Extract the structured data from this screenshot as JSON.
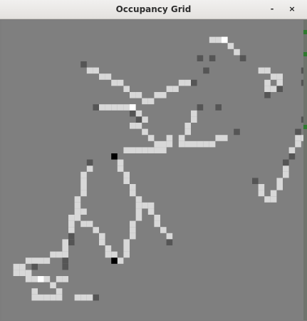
{
  "window": {
    "title": "Occupancy Grid",
    "minimize_label": "-",
    "close_label": "×"
  },
  "colors": {
    "unknown": "#7f7f7f",
    "free": "#d8d8d8",
    "occupied": "#555555",
    "robot": "#000000",
    "highlight": "#ffffff",
    "edge_marker": "#2f7a2f"
  },
  "grid": {
    "free": [
      [
        33,
        1
      ],
      [
        34,
        1
      ],
      [
        35,
        1
      ],
      [
        36,
        2
      ],
      [
        37,
        3
      ],
      [
        13,
        6
      ],
      [
        14,
        6
      ],
      [
        15,
        7
      ],
      [
        16,
        7
      ],
      [
        17,
        8
      ],
      [
        18,
        8
      ],
      [
        19,
        9
      ],
      [
        20,
        10
      ],
      [
        21,
        10
      ],
      [
        22,
        11
      ],
      [
        29,
        8
      ],
      [
        28,
        8
      ],
      [
        27,
        9
      ],
      [
        26,
        9
      ],
      [
        25,
        10
      ],
      [
        24,
        10
      ],
      [
        23,
        11
      ],
      [
        41,
        6
      ],
      [
        42,
        6
      ],
      [
        43,
        7
      ],
      [
        44,
        7
      ],
      [
        42,
        8
      ],
      [
        42,
        9
      ],
      [
        43,
        9
      ],
      [
        44,
        8
      ],
      [
        15,
        12
      ],
      [
        16,
        12
      ],
      [
        17,
        12
      ],
      [
        18,
        12
      ],
      [
        19,
        12
      ],
      [
        20,
        12
      ],
      [
        21,
        13
      ],
      [
        21,
        14
      ],
      [
        22,
        14
      ],
      [
        20,
        15
      ],
      [
        21,
        15
      ],
      [
        22,
        16
      ],
      [
        23,
        17
      ],
      [
        24,
        18
      ],
      [
        25,
        18
      ],
      [
        26,
        18
      ],
      [
        26,
        17
      ],
      [
        25,
        19
      ],
      [
        19,
        19
      ],
      [
        20,
        19
      ],
      [
        21,
        19
      ],
      [
        22,
        19
      ],
      [
        23,
        19
      ],
      [
        24,
        19
      ],
      [
        25,
        19
      ],
      [
        30,
        13
      ],
      [
        30,
        14
      ],
      [
        29,
        15
      ],
      [
        29,
        16
      ],
      [
        28,
        17
      ],
      [
        28,
        18
      ],
      [
        29,
        18
      ],
      [
        30,
        18
      ],
      [
        31,
        18
      ],
      [
        32,
        18
      ],
      [
        33,
        18
      ],
      [
        34,
        17
      ],
      [
        35,
        17
      ],
      [
        18,
        21
      ],
      [
        18,
        22
      ],
      [
        19,
        23
      ],
      [
        19,
        24
      ],
      [
        20,
        25
      ],
      [
        20,
        26
      ],
      [
        21,
        27
      ],
      [
        21,
        28
      ],
      [
        13,
        22
      ],
      [
        12,
        23
      ],
      [
        12,
        24
      ],
      [
        12,
        25
      ],
      [
        12,
        26
      ],
      [
        11,
        27
      ],
      [
        11,
        28
      ],
      [
        22,
        28
      ],
      [
        23,
        28
      ],
      [
        23,
        29
      ],
      [
        24,
        30
      ],
      [
        24,
        31
      ],
      [
        25,
        32
      ],
      [
        26,
        33
      ],
      [
        21,
        29
      ],
      [
        21,
        30
      ],
      [
        20,
        31
      ],
      [
        20,
        32
      ],
      [
        20,
        33
      ],
      [
        19,
        34
      ],
      [
        19,
        35
      ],
      [
        19,
        36
      ],
      [
        18,
        37
      ],
      [
        11,
        29
      ],
      [
        12,
        29
      ],
      [
        11,
        30
      ],
      [
        12,
        31
      ],
      [
        13,
        31
      ],
      [
        14,
        32
      ],
      [
        15,
        33
      ],
      [
        15,
        34
      ],
      [
        16,
        35
      ],
      [
        16,
        36
      ],
      [
        17,
        36
      ],
      [
        10,
        30
      ],
      [
        10,
        31
      ],
      [
        10,
        32
      ],
      [
        10,
        33
      ],
      [
        9,
        34
      ],
      [
        9,
        35
      ],
      [
        9,
        36
      ],
      [
        8,
        36
      ],
      [
        7,
        36
      ],
      [
        6,
        37
      ],
      [
        5,
        37
      ],
      [
        4,
        37
      ],
      [
        3,
        37
      ],
      [
        2,
        38
      ],
      [
        2,
        39
      ],
      [
        1,
        38
      ],
      [
        1,
        39
      ],
      [
        3,
        39
      ],
      [
        3,
        40
      ],
      [
        4,
        40
      ],
      [
        5,
        40
      ],
      [
        6,
        40
      ],
      [
        7,
        41
      ],
      [
        8,
        40
      ],
      [
        9,
        40
      ],
      [
        4,
        42
      ],
      [
        4,
        43
      ],
      [
        5,
        43
      ],
      [
        6,
        43
      ],
      [
        7,
        43
      ],
      [
        8,
        43
      ],
      [
        8,
        42
      ],
      [
        11,
        43
      ],
      [
        12,
        43
      ],
      [
        13,
        43
      ],
      [
        49,
        15
      ],
      [
        49,
        16
      ],
      [
        48,
        17
      ],
      [
        47,
        17
      ],
      [
        47,
        18
      ],
      [
        46,
        19
      ],
      [
        44,
        24
      ],
      [
        44,
        25
      ],
      [
        43,
        26
      ],
      [
        43,
        27
      ],
      [
        42,
        27
      ],
      [
        41,
        26
      ],
      [
        41,
        25
      ],
      [
        45,
        23
      ],
      [
        45,
        22
      ]
    ],
    "occupied": [
      [
        12,
        5
      ],
      [
        31,
        4
      ],
      [
        32,
        6
      ],
      [
        33,
        4
      ],
      [
        38,
        4
      ],
      [
        30,
        8
      ],
      [
        48,
        6
      ],
      [
        49,
        7
      ],
      [
        48,
        8
      ],
      [
        44,
        9
      ],
      [
        42,
        10
      ],
      [
        14,
        12
      ],
      [
        20,
        13
      ],
      [
        21,
        14
      ],
      [
        31,
        12
      ],
      [
        37,
        16
      ],
      [
        34,
        12
      ],
      [
        13,
        21
      ],
      [
        10,
        33
      ],
      [
        10,
        34
      ],
      [
        9,
        37
      ],
      [
        26,
        34
      ],
      [
        48,
        14
      ],
      [
        47,
        16
      ],
      [
        46,
        20
      ],
      [
        45,
        21
      ],
      [
        40,
        24
      ],
      [
        4,
        38
      ],
      [
        9,
        38
      ],
      [
        14,
        43
      ]
    ],
    "robot": [
      [
        17,
        20
      ],
      [
        17,
        37
      ]
    ],
    "highlight": [
      [
        35,
        1
      ],
      [
        20,
        12
      ],
      [
        5,
        40
      ]
    ]
  }
}
